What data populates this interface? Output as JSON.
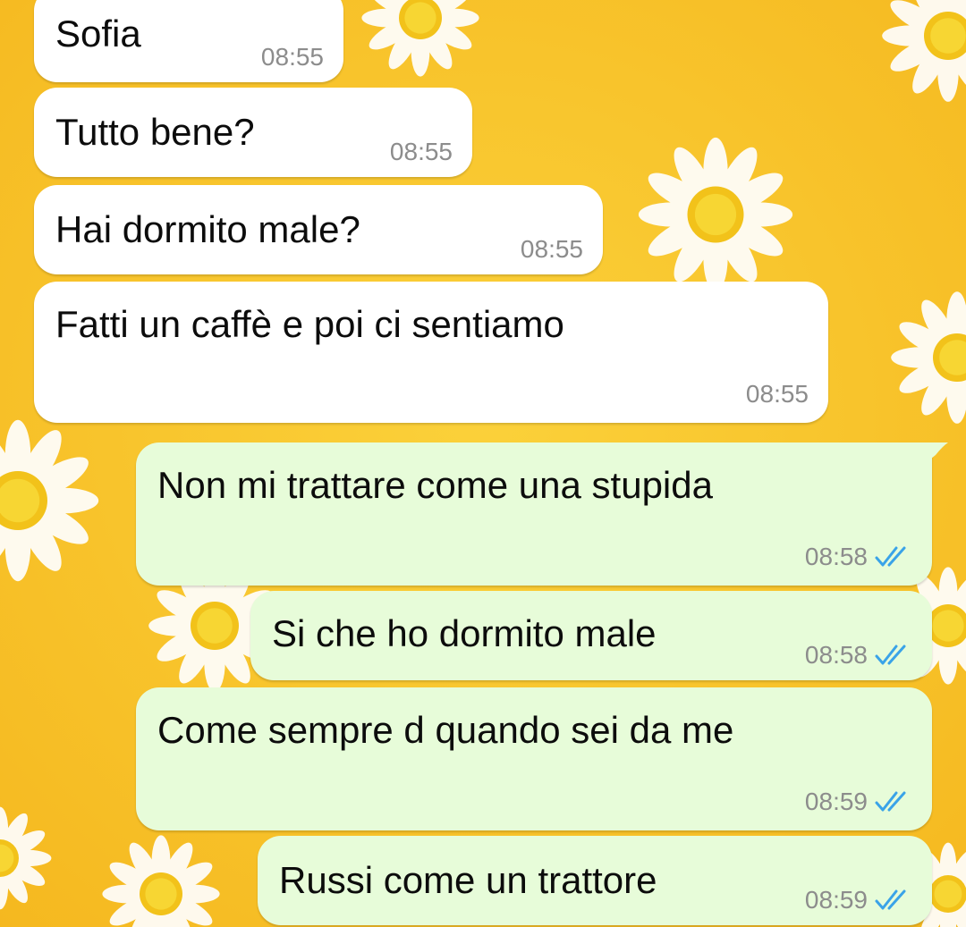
{
  "colors": {
    "wallpaper": "#f8c32a",
    "incoming_bubble": "#ffffff",
    "outgoing_bubble": "#e7fcd9",
    "read_ticks": "#3aa3e8"
  },
  "wallpaper": {
    "pattern": "daisy-flowers"
  },
  "messages": [
    {
      "direction": "incoming",
      "text": "Sofia",
      "time": "08:55"
    },
    {
      "direction": "incoming",
      "text": "Tutto bene?",
      "time": "08:55"
    },
    {
      "direction": "incoming",
      "text": "Hai dormito male?",
      "time": "08:55"
    },
    {
      "direction": "incoming",
      "text": "Fatti un caffè e poi ci sentiamo",
      "time": "08:55"
    },
    {
      "direction": "outgoing",
      "text": "Non mi trattare come una stupida",
      "time": "08:58",
      "status_icon": "double-check-read-icon"
    },
    {
      "direction": "outgoing",
      "text": "Si che ho dormito male",
      "time": "08:58",
      "status_icon": "double-check-read-icon"
    },
    {
      "direction": "outgoing",
      "text": "Come sempre d quando sei da me",
      "time": "08:59",
      "status_icon": "double-check-read-icon"
    },
    {
      "direction": "outgoing",
      "text": "Russi come un trattore",
      "time": "08:59",
      "status_icon": "double-check-read-icon"
    }
  ]
}
